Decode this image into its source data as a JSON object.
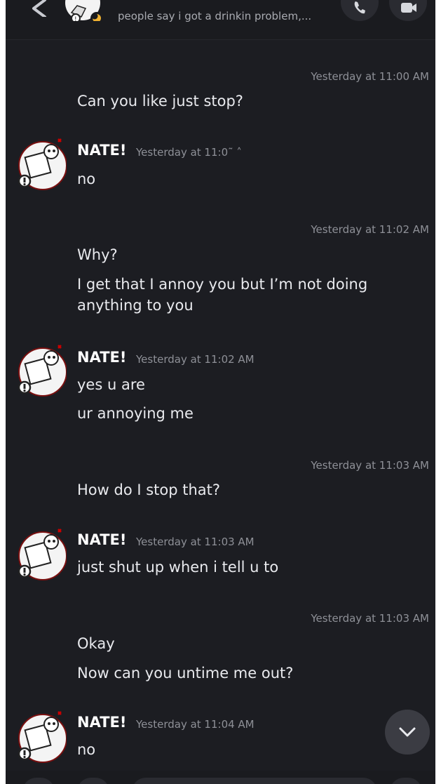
{
  "header": {
    "status_text": "people say i got a drinkin problem,..."
  },
  "messages": [
    {
      "type": "self",
      "timestamp": "Yesterday at 11:00 AM",
      "lines": [
        "Can you like just stop?"
      ]
    },
    {
      "type": "other",
      "author": "NATE!",
      "timestamp": "Yesterday at 11:0˜ ˄",
      "lines": [
        "no"
      ]
    },
    {
      "type": "self",
      "timestamp": "Yesterday at 11:02 AM",
      "lines": [
        "Why?",
        "I get that I annoy you but I’m not doing anything to you"
      ]
    },
    {
      "type": "other",
      "author": "NATE!",
      "timestamp": "Yesterday at 11:02 AM",
      "lines": [
        "yes u are",
        "ur annoying me"
      ]
    },
    {
      "type": "self",
      "timestamp": "Yesterday at 11:03 AM",
      "lines": [
        "How do I stop that?"
      ]
    },
    {
      "type": "other",
      "author": "NATE!",
      "timestamp": "Yesterday at 11:03 AM",
      "lines": [
        "just shut up when i tell u to"
      ]
    },
    {
      "type": "self",
      "timestamp": "Yesterday at 11:03 AM",
      "lines": [
        "Okay",
        "Now can you untime me out?"
      ]
    },
    {
      "type": "other",
      "author": "NATE!",
      "timestamp": "Yesterday at 11:04 AM",
      "lines": [
        "no"
      ]
    }
  ],
  "icons": [
    "back-arrow-icon",
    "phone-icon",
    "video-camera-icon",
    "chevron-down-icon",
    "moon-status-icon"
  ],
  "colors": {
    "background": "#1c1d22",
    "text": "#e9eaee",
    "timestamp": "#8e9097"
  }
}
